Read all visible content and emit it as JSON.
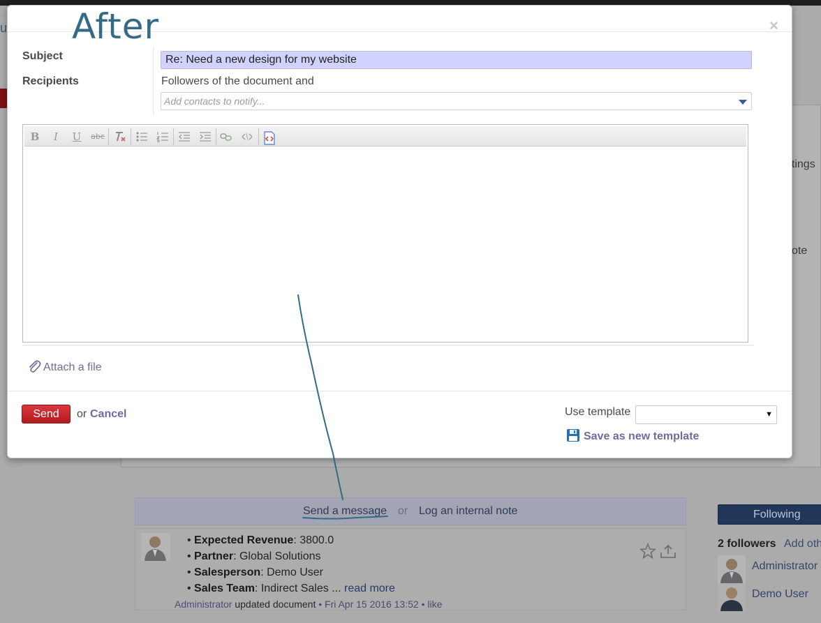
{
  "annotation": {
    "title": "After",
    "color": "#336b87"
  },
  "dialog": {
    "close_glyph": "×",
    "subject_label": "Subject",
    "subject_value": "Re: Need a new design for my website",
    "recipients_label": "Recipients",
    "followers_text": "Followers of the document and",
    "contacts_placeholder": "Add contacts to notify...",
    "editor_toolbar": [
      "bold",
      "italic",
      "underline",
      "strikethrough",
      "remove-format",
      "unordered-list",
      "ordered-list",
      "outdent",
      "indent",
      "link",
      "unlink",
      "html-source"
    ],
    "attach_label": "Attach a file",
    "send_label": "Send",
    "or_label": "or",
    "cancel_label": "Cancel",
    "use_template_label": "Use template",
    "template_selected": "",
    "save_template_label": "Save as new template",
    "colors": {
      "send": "#c62a2f",
      "link": "#6d6c9c",
      "subject_bg": "#d2d2fe"
    }
  },
  "background": {
    "fragments": {
      "meetings": "etings",
      "note": "ote"
    },
    "composer": {
      "send_message": "Send a message",
      "or": "or",
      "log_note": "Log an internal note"
    },
    "message": {
      "fields": [
        {
          "label": "Expected Revenue",
          "value": ": 3800.0"
        },
        {
          "label": "Partner",
          "value": ": Global Solutions"
        },
        {
          "label": "Salesperson",
          "value": ": Demo User"
        },
        {
          "label": "Sales Team",
          "value": ": Indirect Sales ..."
        }
      ],
      "read_more": "read more",
      "author": "Administrator",
      "action": "updated document",
      "separator": "•",
      "date": "Fri Apr 15 2016 13:52",
      "like": "like"
    },
    "followers": {
      "button": "Following",
      "count": "2 followers",
      "add": "Add oth",
      "list": [
        "Administrator",
        "Demo User"
      ]
    }
  }
}
